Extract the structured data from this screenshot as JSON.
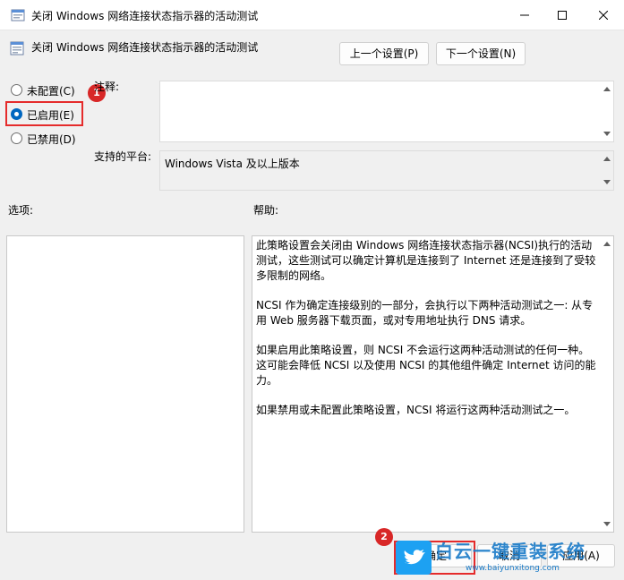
{
  "window": {
    "title": "关闭 Windows 网络连接状态指示器的活动测试",
    "minimize_icon": "minimize-icon",
    "maximize_icon": "maximize-icon",
    "close_icon": "close-icon"
  },
  "policy": {
    "name": "关闭 Windows 网络连接状态指示器的活动测试"
  },
  "nav": {
    "prev_label": "上一个设置(P)",
    "next_label": "下一个设置(N)"
  },
  "state": {
    "options": [
      {
        "label": "未配置(C)",
        "checked": false
      },
      {
        "label": "已启用(E)",
        "checked": true
      },
      {
        "label": "已禁用(D)",
        "checked": false
      }
    ]
  },
  "comment": {
    "label": "注释:",
    "value": ""
  },
  "platform": {
    "label": "支持的平台:",
    "value": "Windows Vista 及以上版本"
  },
  "options_section": {
    "label": "选项:"
  },
  "help": {
    "label": "帮助:",
    "paragraphs": [
      "此策略设置会关闭由 Windows 网络连接状态指示器(NCSI)执行的活动测试，这些测试可以确定计算机是连接到了 Internet 还是连接到了受较多限制的网络。",
      "NCSI 作为确定连接级别的一部分，会执行以下两种活动测试之一: 从专用 Web 服务器下载页面，或对专用地址执行 DNS 请求。",
      "如果启用此策略设置，则 NCSI 不会运行这两种活动测试的任何一种。这可能会降低 NCSI 以及使用 NCSI 的其他组件确定 Internet 访问的能力。",
      "如果禁用或未配置此策略设置，NCSI 将运行这两种活动测试之一。"
    ]
  },
  "buttons": {
    "ok_label": "确定",
    "cancel_label": "取消",
    "apply_label": "应用(A)"
  },
  "markers": {
    "step1": "1",
    "step2": "2"
  },
  "watermark": {
    "brand": "白云一键重装系统",
    "url": "www.baiyunxitong.com"
  },
  "colors": {
    "highlight": "#e52b2b",
    "radio_accent": "#0067c0",
    "watermark": "#1a7bc8"
  }
}
